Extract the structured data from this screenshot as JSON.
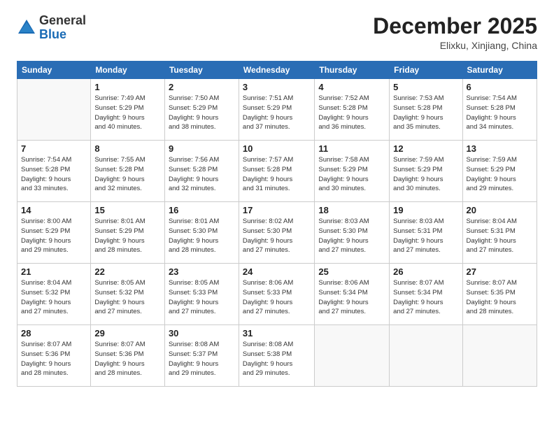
{
  "header": {
    "logo_general": "General",
    "logo_blue": "Blue",
    "month": "December 2025",
    "location": "Elixku, Xinjiang, China"
  },
  "days_of_week": [
    "Sunday",
    "Monday",
    "Tuesday",
    "Wednesday",
    "Thursday",
    "Friday",
    "Saturday"
  ],
  "weeks": [
    [
      {
        "day": "",
        "info": ""
      },
      {
        "day": "1",
        "info": "Sunrise: 7:49 AM\nSunset: 5:29 PM\nDaylight: 9 hours\nand 40 minutes."
      },
      {
        "day": "2",
        "info": "Sunrise: 7:50 AM\nSunset: 5:29 PM\nDaylight: 9 hours\nand 38 minutes."
      },
      {
        "day": "3",
        "info": "Sunrise: 7:51 AM\nSunset: 5:29 PM\nDaylight: 9 hours\nand 37 minutes."
      },
      {
        "day": "4",
        "info": "Sunrise: 7:52 AM\nSunset: 5:28 PM\nDaylight: 9 hours\nand 36 minutes."
      },
      {
        "day": "5",
        "info": "Sunrise: 7:53 AM\nSunset: 5:28 PM\nDaylight: 9 hours\nand 35 minutes."
      },
      {
        "day": "6",
        "info": "Sunrise: 7:54 AM\nSunset: 5:28 PM\nDaylight: 9 hours\nand 34 minutes."
      }
    ],
    [
      {
        "day": "7",
        "info": "Sunrise: 7:54 AM\nSunset: 5:28 PM\nDaylight: 9 hours\nand 33 minutes."
      },
      {
        "day": "8",
        "info": "Sunrise: 7:55 AM\nSunset: 5:28 PM\nDaylight: 9 hours\nand 32 minutes."
      },
      {
        "day": "9",
        "info": "Sunrise: 7:56 AM\nSunset: 5:28 PM\nDaylight: 9 hours\nand 32 minutes."
      },
      {
        "day": "10",
        "info": "Sunrise: 7:57 AM\nSunset: 5:28 PM\nDaylight: 9 hours\nand 31 minutes."
      },
      {
        "day": "11",
        "info": "Sunrise: 7:58 AM\nSunset: 5:29 PM\nDaylight: 9 hours\nand 30 minutes."
      },
      {
        "day": "12",
        "info": "Sunrise: 7:59 AM\nSunset: 5:29 PM\nDaylight: 9 hours\nand 30 minutes."
      },
      {
        "day": "13",
        "info": "Sunrise: 7:59 AM\nSunset: 5:29 PM\nDaylight: 9 hours\nand 29 minutes."
      }
    ],
    [
      {
        "day": "14",
        "info": "Sunrise: 8:00 AM\nSunset: 5:29 PM\nDaylight: 9 hours\nand 29 minutes."
      },
      {
        "day": "15",
        "info": "Sunrise: 8:01 AM\nSunset: 5:29 PM\nDaylight: 9 hours\nand 28 minutes."
      },
      {
        "day": "16",
        "info": "Sunrise: 8:01 AM\nSunset: 5:30 PM\nDaylight: 9 hours\nand 28 minutes."
      },
      {
        "day": "17",
        "info": "Sunrise: 8:02 AM\nSunset: 5:30 PM\nDaylight: 9 hours\nand 27 minutes."
      },
      {
        "day": "18",
        "info": "Sunrise: 8:03 AM\nSunset: 5:30 PM\nDaylight: 9 hours\nand 27 minutes."
      },
      {
        "day": "19",
        "info": "Sunrise: 8:03 AM\nSunset: 5:31 PM\nDaylight: 9 hours\nand 27 minutes."
      },
      {
        "day": "20",
        "info": "Sunrise: 8:04 AM\nSunset: 5:31 PM\nDaylight: 9 hours\nand 27 minutes."
      }
    ],
    [
      {
        "day": "21",
        "info": "Sunrise: 8:04 AM\nSunset: 5:32 PM\nDaylight: 9 hours\nand 27 minutes."
      },
      {
        "day": "22",
        "info": "Sunrise: 8:05 AM\nSunset: 5:32 PM\nDaylight: 9 hours\nand 27 minutes."
      },
      {
        "day": "23",
        "info": "Sunrise: 8:05 AM\nSunset: 5:33 PM\nDaylight: 9 hours\nand 27 minutes."
      },
      {
        "day": "24",
        "info": "Sunrise: 8:06 AM\nSunset: 5:33 PM\nDaylight: 9 hours\nand 27 minutes."
      },
      {
        "day": "25",
        "info": "Sunrise: 8:06 AM\nSunset: 5:34 PM\nDaylight: 9 hours\nand 27 minutes."
      },
      {
        "day": "26",
        "info": "Sunrise: 8:07 AM\nSunset: 5:34 PM\nDaylight: 9 hours\nand 27 minutes."
      },
      {
        "day": "27",
        "info": "Sunrise: 8:07 AM\nSunset: 5:35 PM\nDaylight: 9 hours\nand 28 minutes."
      }
    ],
    [
      {
        "day": "28",
        "info": "Sunrise: 8:07 AM\nSunset: 5:36 PM\nDaylight: 9 hours\nand 28 minutes."
      },
      {
        "day": "29",
        "info": "Sunrise: 8:07 AM\nSunset: 5:36 PM\nDaylight: 9 hours\nand 28 minutes."
      },
      {
        "day": "30",
        "info": "Sunrise: 8:08 AM\nSunset: 5:37 PM\nDaylight: 9 hours\nand 29 minutes."
      },
      {
        "day": "31",
        "info": "Sunrise: 8:08 AM\nSunset: 5:38 PM\nDaylight: 9 hours\nand 29 minutes."
      },
      {
        "day": "",
        "info": ""
      },
      {
        "day": "",
        "info": ""
      },
      {
        "day": "",
        "info": ""
      }
    ]
  ]
}
